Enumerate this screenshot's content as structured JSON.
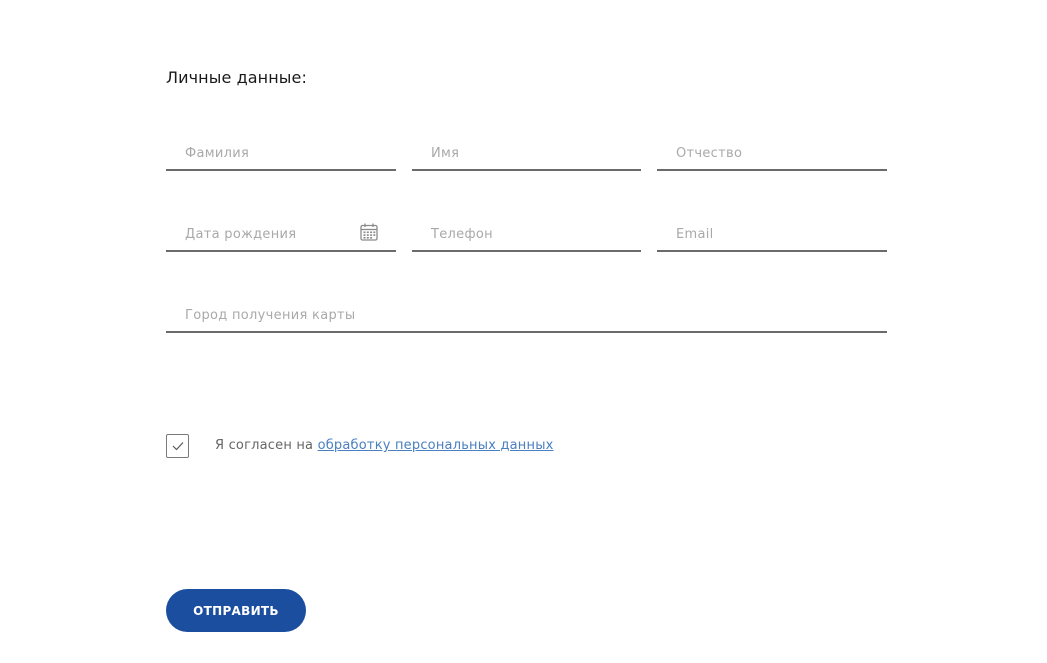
{
  "section": {
    "title": "Личные данные:"
  },
  "fields": {
    "lastname": {
      "placeholder": "Фамилия",
      "value": ""
    },
    "firstname": {
      "placeholder": "Имя",
      "value": ""
    },
    "middlename": {
      "placeholder": "Отчество",
      "value": ""
    },
    "birthdate": {
      "placeholder": "Дата рождения",
      "value": "",
      "icon": "calendar-icon"
    },
    "phone": {
      "placeholder": "Телефон",
      "value": ""
    },
    "email": {
      "placeholder": "Email",
      "value": ""
    },
    "city": {
      "placeholder": "Город получения карты",
      "value": ""
    }
  },
  "consent": {
    "checked": true,
    "text": "Я согласен на ",
    "link_text": "обработку персональных данных",
    "icon": "checkmark-icon"
  },
  "submit": {
    "label": "ОТПРАВИТЬ"
  },
  "colors": {
    "accent": "#1c4ea0",
    "link": "#4a7fc0",
    "field_border": "#6b6b6b",
    "placeholder": "#a9a9a9"
  }
}
